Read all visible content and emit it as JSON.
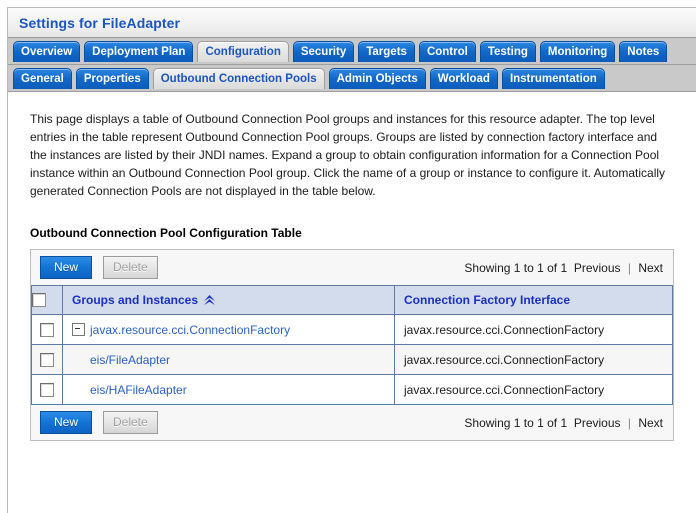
{
  "window": {
    "title": "Settings for FileAdapter"
  },
  "primary_tabs": [
    {
      "label": "Overview",
      "active": false
    },
    {
      "label": "Deployment Plan",
      "active": false
    },
    {
      "label": "Configuration",
      "active": true
    },
    {
      "label": "Security",
      "active": false
    },
    {
      "label": "Targets",
      "active": false
    },
    {
      "label": "Control",
      "active": false
    },
    {
      "label": "Testing",
      "active": false
    },
    {
      "label": "Monitoring",
      "active": false
    },
    {
      "label": "Notes",
      "active": false
    }
  ],
  "secondary_tabs": [
    {
      "label": "General",
      "active": false
    },
    {
      "label": "Properties",
      "active": false
    },
    {
      "label": "Outbound Connection Pools",
      "active": true
    },
    {
      "label": "Admin Objects",
      "active": false
    },
    {
      "label": "Workload",
      "active": false
    },
    {
      "label": "Instrumentation",
      "active": false
    }
  ],
  "content": {
    "intro": "This page displays a table of Outbound Connection Pool groups and instances for this resource adapter. The top level entries in the table represent Outbound Connection Pool groups. Groups are listed by connection factory interface and the instances are listed by their JNDI names. Expand a group to obtain configuration information for a Connection Pool instance within an Outbound Connection Pool group. Click the name of a group or instance to configure it. Automatically generated Connection Pools are not displayed in the table below.",
    "section_title": "Outbound Connection Pool Configuration Table"
  },
  "toolbar": {
    "new_label": "New",
    "delete_label": "Delete",
    "showing_text": "Showing 1 to 1 of 1",
    "previous_label": "Previous",
    "separator": "|",
    "next_label": "Next"
  },
  "table": {
    "columns": [
      {
        "label": "Groups and Instances",
        "sort": "ascending"
      },
      {
        "label": "Connection Factory Interface",
        "sort": "none"
      }
    ],
    "rows": [
      {
        "name": "javax.resource.cci.ConnectionFactory",
        "interface": "javax.resource.cci.ConnectionFactory",
        "expandable": true,
        "expanded": true,
        "indent": false,
        "checked": false
      },
      {
        "name": "eis/FileAdapter",
        "interface": "javax.resource.cci.ConnectionFactory",
        "expandable": false,
        "expanded": false,
        "indent": true,
        "checked": false
      },
      {
        "name": "eis/HAFileAdapter",
        "interface": "javax.resource.cci.ConnectionFactory",
        "expandable": false,
        "expanded": false,
        "indent": true,
        "checked": false
      }
    ]
  },
  "colors": {
    "tab_blue": "#1168c8",
    "link_blue": "#2a5fc8",
    "header_blue": "#1b2fc4",
    "table_header_bg": "#d2dcec",
    "grid_border": "#5c7b9e"
  }
}
